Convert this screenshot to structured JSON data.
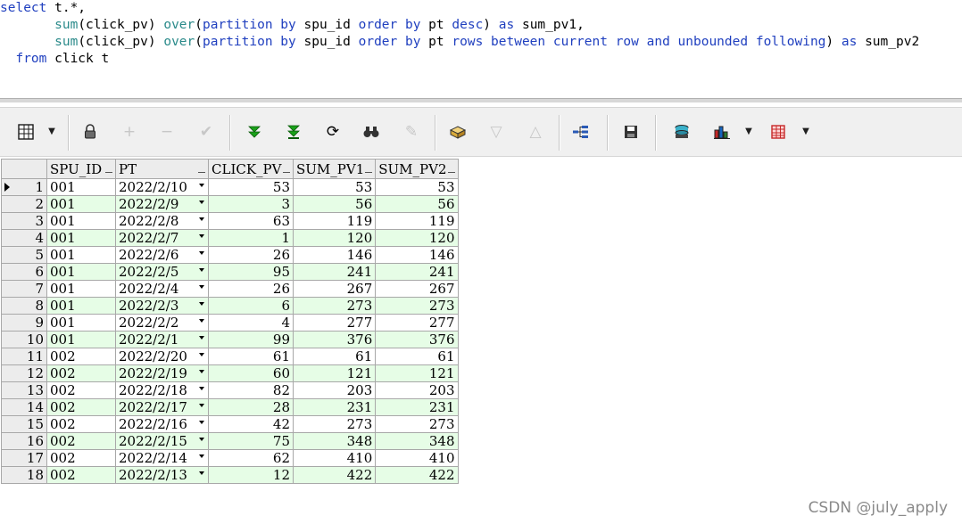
{
  "sql": {
    "line1": {
      "kw_select": "select",
      "rest": " t.*,"
    },
    "line2": {
      "indent": "       ",
      "fn_sum": "sum",
      "arg": "(click_pv) ",
      "kw_over": "over",
      "p1": "(",
      "kw_partition": "partition by",
      "p2": " spu_id ",
      "kw_order": "order by",
      "p3": " pt ",
      "kw_desc": "desc",
      "p4": ") ",
      "kw_as": "as",
      "p5": " sum_pv1,"
    },
    "line3": {
      "indent": "       ",
      "fn_sum": "sum",
      "arg": "(click_pv) ",
      "kw_over": "over",
      "p1": "(",
      "kw_partition": "partition by",
      "p2": " spu_id ",
      "kw_order": "order by",
      "p3": " pt ",
      "kw_rows": "rows between current row and unbounded following",
      "p4": ") ",
      "kw_as": "as",
      "p5": " sum_pv2"
    },
    "line4": {
      "indent": "  ",
      "kw_from": "from",
      "rest": " click t"
    }
  },
  "toolbar": {
    "icons": [
      "grid-view-icon",
      "dropdown-arrow-icon",
      "lock-icon",
      "add-record-icon",
      "delete-record-icon",
      "post-changes-icon",
      "fetch-next-page-icon",
      "fetch-last-page-icon",
      "refresh-icon",
      "find-icon",
      "clear-icon",
      "query-by-example-icon",
      "filter-icon",
      "sort-icon",
      "explain-plan-icon",
      "save-icon",
      "export-icon",
      "chart-icon",
      "dropdown-arrow-icon",
      "table-icon",
      "dropdown-arrow-icon"
    ]
  },
  "grid": {
    "columns": [
      "SPU_ID",
      "PT",
      "CLICK_PV",
      "SUM_PV1",
      "SUM_PV2"
    ],
    "rows": [
      {
        "n": "1",
        "spu_id": "001",
        "pt": "2022/2/10",
        "click_pv": "53",
        "sum_pv1": "53",
        "sum_pv2": "53"
      },
      {
        "n": "2",
        "spu_id": "001",
        "pt": "2022/2/9",
        "click_pv": "3",
        "sum_pv1": "56",
        "sum_pv2": "56"
      },
      {
        "n": "3",
        "spu_id": "001",
        "pt": "2022/2/8",
        "click_pv": "63",
        "sum_pv1": "119",
        "sum_pv2": "119"
      },
      {
        "n": "4",
        "spu_id": "001",
        "pt": "2022/2/7",
        "click_pv": "1",
        "sum_pv1": "120",
        "sum_pv2": "120"
      },
      {
        "n": "5",
        "spu_id": "001",
        "pt": "2022/2/6",
        "click_pv": "26",
        "sum_pv1": "146",
        "sum_pv2": "146"
      },
      {
        "n": "6",
        "spu_id": "001",
        "pt": "2022/2/5",
        "click_pv": "95",
        "sum_pv1": "241",
        "sum_pv2": "241"
      },
      {
        "n": "7",
        "spu_id": "001",
        "pt": "2022/2/4",
        "click_pv": "26",
        "sum_pv1": "267",
        "sum_pv2": "267"
      },
      {
        "n": "8",
        "spu_id": "001",
        "pt": "2022/2/3",
        "click_pv": "6",
        "sum_pv1": "273",
        "sum_pv2": "273"
      },
      {
        "n": "9",
        "spu_id": "001",
        "pt": "2022/2/2",
        "click_pv": "4",
        "sum_pv1": "277",
        "sum_pv2": "277"
      },
      {
        "n": "10",
        "spu_id": "001",
        "pt": "2022/2/1",
        "click_pv": "99",
        "sum_pv1": "376",
        "sum_pv2": "376"
      },
      {
        "n": "11",
        "spu_id": "002",
        "pt": "2022/2/20",
        "click_pv": "61",
        "sum_pv1": "61",
        "sum_pv2": "61"
      },
      {
        "n": "12",
        "spu_id": "002",
        "pt": "2022/2/19",
        "click_pv": "60",
        "sum_pv1": "121",
        "sum_pv2": "121"
      },
      {
        "n": "13",
        "spu_id": "002",
        "pt": "2022/2/18",
        "click_pv": "82",
        "sum_pv1": "203",
        "sum_pv2": "203"
      },
      {
        "n": "14",
        "spu_id": "002",
        "pt": "2022/2/17",
        "click_pv": "28",
        "sum_pv1": "231",
        "sum_pv2": "231"
      },
      {
        "n": "15",
        "spu_id": "002",
        "pt": "2022/2/16",
        "click_pv": "42",
        "sum_pv1": "273",
        "sum_pv2": "273"
      },
      {
        "n": "16",
        "spu_id": "002",
        "pt": "2022/2/15",
        "click_pv": "75",
        "sum_pv1": "348",
        "sum_pv2": "348"
      },
      {
        "n": "17",
        "spu_id": "002",
        "pt": "2022/2/14",
        "click_pv": "62",
        "sum_pv1": "410",
        "sum_pv2": "410"
      },
      {
        "n": "18",
        "spu_id": "002",
        "pt": "2022/2/13",
        "click_pv": "12",
        "sum_pv1": "422",
        "sum_pv2": "422"
      }
    ]
  },
  "watermark": "CSDN @july_apply",
  "colors": {
    "keyword": "#1f3fbf",
    "function": "#2a8a8a",
    "alt_row": "#e6fde6",
    "header_bg": "#ececec"
  }
}
